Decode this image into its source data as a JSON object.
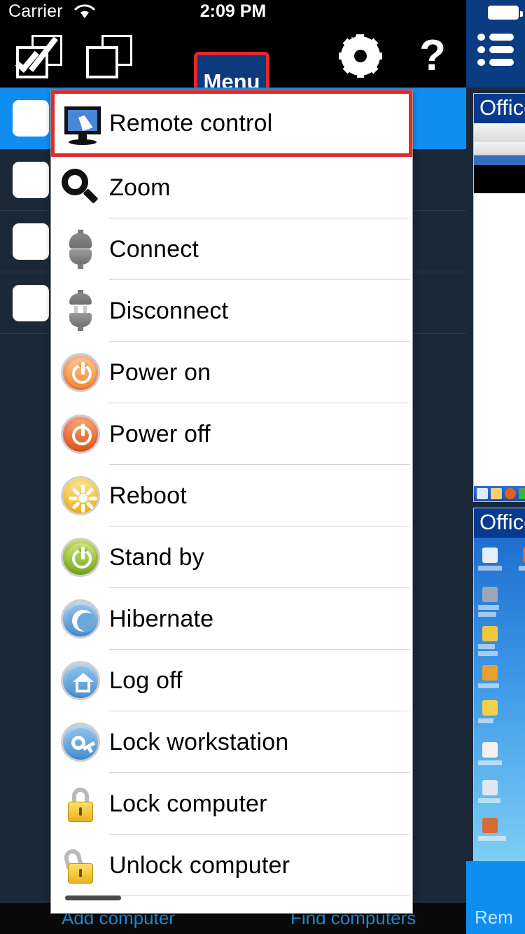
{
  "status_bar": {
    "carrier": "Carrier",
    "wifi_icon": "wifi-icon",
    "time": "2:09 PM",
    "battery_icon": "battery-full-icon"
  },
  "toolbar": {
    "select_all_icon": "select-all-checkbox-icon",
    "deselect_all_icon": "deselect-all-squares-icon",
    "menu_label": "Menu",
    "settings_icon": "gear-icon",
    "help_label": "?",
    "list_view_icon": "list-view-icon",
    "highlight_color": "#e02b2b",
    "menu_button_color": "#0d3a7d"
  },
  "menu": {
    "items": [
      {
        "label": "Remote control",
        "icon": "monitor-cursor-icon",
        "highlighted": true
      },
      {
        "label": "Zoom",
        "icon": "magnifier-icon",
        "highlighted": false
      },
      {
        "label": "Connect",
        "icon": "plug-connected-icon",
        "highlighted": false
      },
      {
        "label": "Disconnect",
        "icon": "plug-disconnected-icon",
        "highlighted": false
      },
      {
        "label": "Power on",
        "icon": "power-on-orb-icon",
        "highlighted": false
      },
      {
        "label": "Power off",
        "icon": "power-off-orb-icon",
        "highlighted": false
      },
      {
        "label": "Reboot",
        "icon": "reboot-sun-orb-icon",
        "highlighted": false
      },
      {
        "label": "Stand by",
        "icon": "standby-green-orb-icon",
        "highlighted": false
      },
      {
        "label": "Hibernate",
        "icon": "hibernate-moon-icon",
        "highlighted": false
      },
      {
        "label": "Log off",
        "icon": "log-off-house-icon",
        "highlighted": false
      },
      {
        "label": "Lock workstation",
        "icon": "key-orb-icon",
        "highlighted": false
      },
      {
        "label": "Lock computer",
        "icon": "padlock-closed-icon",
        "highlighted": false
      },
      {
        "label": "Unlock computer",
        "icon": "padlock-open-icon",
        "highlighted": false
      }
    ]
  },
  "computer_list": {
    "rows": [
      {
        "selected": true,
        "checkbox": "unchecked"
      },
      {
        "selected": false,
        "checkbox": "unchecked"
      },
      {
        "selected": false,
        "checkbox": "unchecked"
      },
      {
        "selected": false,
        "checkbox": "unchecked"
      }
    ],
    "selected_color": "#108ef0",
    "background_color": "#1b2838"
  },
  "thumbnails": [
    {
      "title": "Office",
      "type": "word-document"
    },
    {
      "title": "Office",
      "type": "xp-desktop"
    }
  ],
  "remote_strip": {
    "label": "Rem"
  },
  "bottom_bar": {
    "add_computer": "Add computer",
    "find_computers": "Find computers",
    "link_color": "#1f8ad0"
  }
}
